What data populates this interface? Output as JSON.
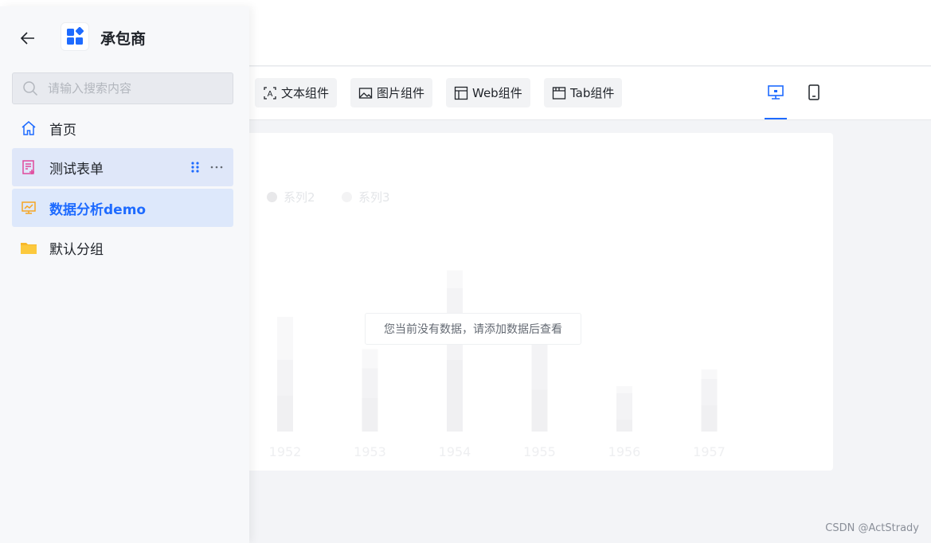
{
  "sidebar": {
    "app_title": "承包商",
    "search_placeholder": "请输入搜索内容",
    "items": [
      {
        "label": "首页",
        "icon": "home-icon"
      },
      {
        "label": "测试表单",
        "icon": "form-icon"
      },
      {
        "label": "数据分析demo",
        "icon": "dashboard-icon"
      },
      {
        "label": "默认分组",
        "icon": "folder-icon"
      }
    ]
  },
  "toolbar": {
    "buttons": [
      {
        "label": "文本组件",
        "icon": "text-component-icon"
      },
      {
        "label": "图片组件",
        "icon": "image-component-icon"
      },
      {
        "label": "Web组件",
        "icon": "web-component-icon"
      },
      {
        "label": "Tab组件",
        "icon": "tab-component-icon"
      }
    ],
    "views": [
      {
        "name": "desktop-view",
        "active": true
      },
      {
        "name": "mobile-view",
        "active": false
      }
    ]
  },
  "canvas": {
    "empty_message": "您当前没有数据，请添加数据后查看"
  },
  "chart_data": {
    "type": "bar",
    "categories": [
      "1952",
      "1953",
      "1954",
      "1955",
      "1956",
      "1957"
    ],
    "series": [
      {
        "name": "",
        "values": [
          30,
          28,
          60,
          35,
          10,
          22
        ]
      },
      {
        "name": "系列2",
        "values": [
          30,
          25,
          60,
          45,
          22,
          22
        ]
      },
      {
        "name": "系列3",
        "values": [
          36,
          16,
          15,
          10,
          6,
          8
        ]
      }
    ],
    "ylim": [
      0,
      160
    ],
    "grid": false,
    "legend_position": "top-left",
    "colors": [
      "#f0f0f2",
      "#f3f3f5",
      "#f8f8f9"
    ]
  },
  "watermark": "CSDN @ActStrady",
  "colors": {
    "accent": "#1e6bff",
    "sidebar_bg": "#f7f8fa",
    "active_bg": "#dde8fb"
  }
}
